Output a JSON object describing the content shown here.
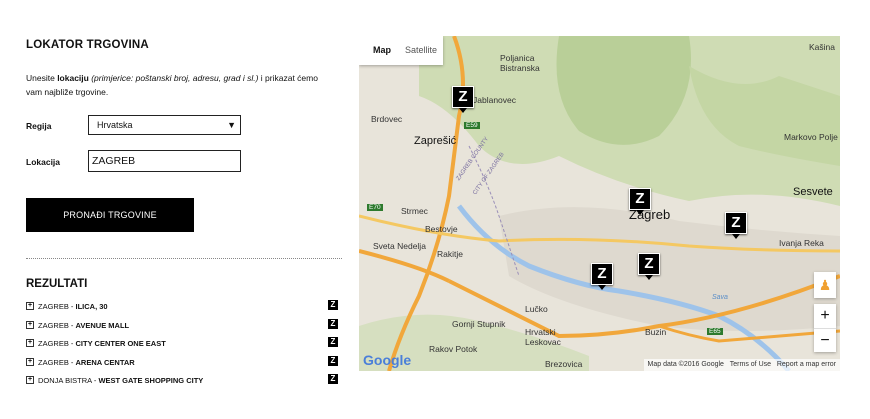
{
  "locator": {
    "title": "LOKATOR TRGOVINA",
    "intro_pre": "Unesite ",
    "intro_bold": "lokaciju",
    "intro_italic": " (primjerice: poštanski broj, adresu, grad i sl.)",
    "intro_post": " i prikazat ćemo vam najbliže trgovine.",
    "region_label": "Regija",
    "region_value": "Hrvatska",
    "location_label": "Lokacija",
    "location_value": "ZAGREB",
    "search_button": "PRONAĐI TRGOVINE"
  },
  "results": {
    "title": "REZULTATI",
    "items": [
      {
        "city": "ZAGREB - ",
        "store": "ILICA, 30"
      },
      {
        "city": "ZAGREB - ",
        "store": "AVENUE MALL"
      },
      {
        "city": "ZAGREB - ",
        "store": "CITY CENTER ONE EAST"
      },
      {
        "city": "ZAGREB - ",
        "store": "ARENA CENTAR"
      },
      {
        "city": "DONJA BISTRA - ",
        "store": "WEST GATE SHOPPING CITY"
      }
    ],
    "item_icon": "z-store-icon"
  },
  "map": {
    "type_map": "Map",
    "type_satellite": "Satellite",
    "zoom_in": "+",
    "zoom_out": "−",
    "attribution": "Map data ©2016 Google",
    "terms": "Terms of Use",
    "report": "Report a map error",
    "logo": "Google",
    "places": {
      "kasina": "Kašina",
      "poljanica": "Poljanica Bistranska",
      "jablanovec": "Jablanovec",
      "brdovec": "Brdovec",
      "zapresic": "Zaprešić",
      "markovo": "Markovo Polje",
      "sesvete": "Sesvete",
      "zagreb": "Zagreb",
      "strmec": "Strmec",
      "bestovje": "Bestovje",
      "sveta": "Sveta Nedelja",
      "rakitje": "Rakitje",
      "ivanja": "Ivanja Reka",
      "lucko": "Lučko",
      "gornji": "Gornji Stupnik",
      "hrvatski": "Hrvatski Leskovac",
      "buzin": "Buzin",
      "rakov": "Rakov Potok",
      "brezovica": "Brezovica",
      "county": "ZAGREB COUNTY",
      "city": "CITY OF ZAGREB",
      "e59": "E59",
      "e70": "E70",
      "e65": "E65",
      "sava": "Sava"
    },
    "marker_glyph": "Z"
  }
}
